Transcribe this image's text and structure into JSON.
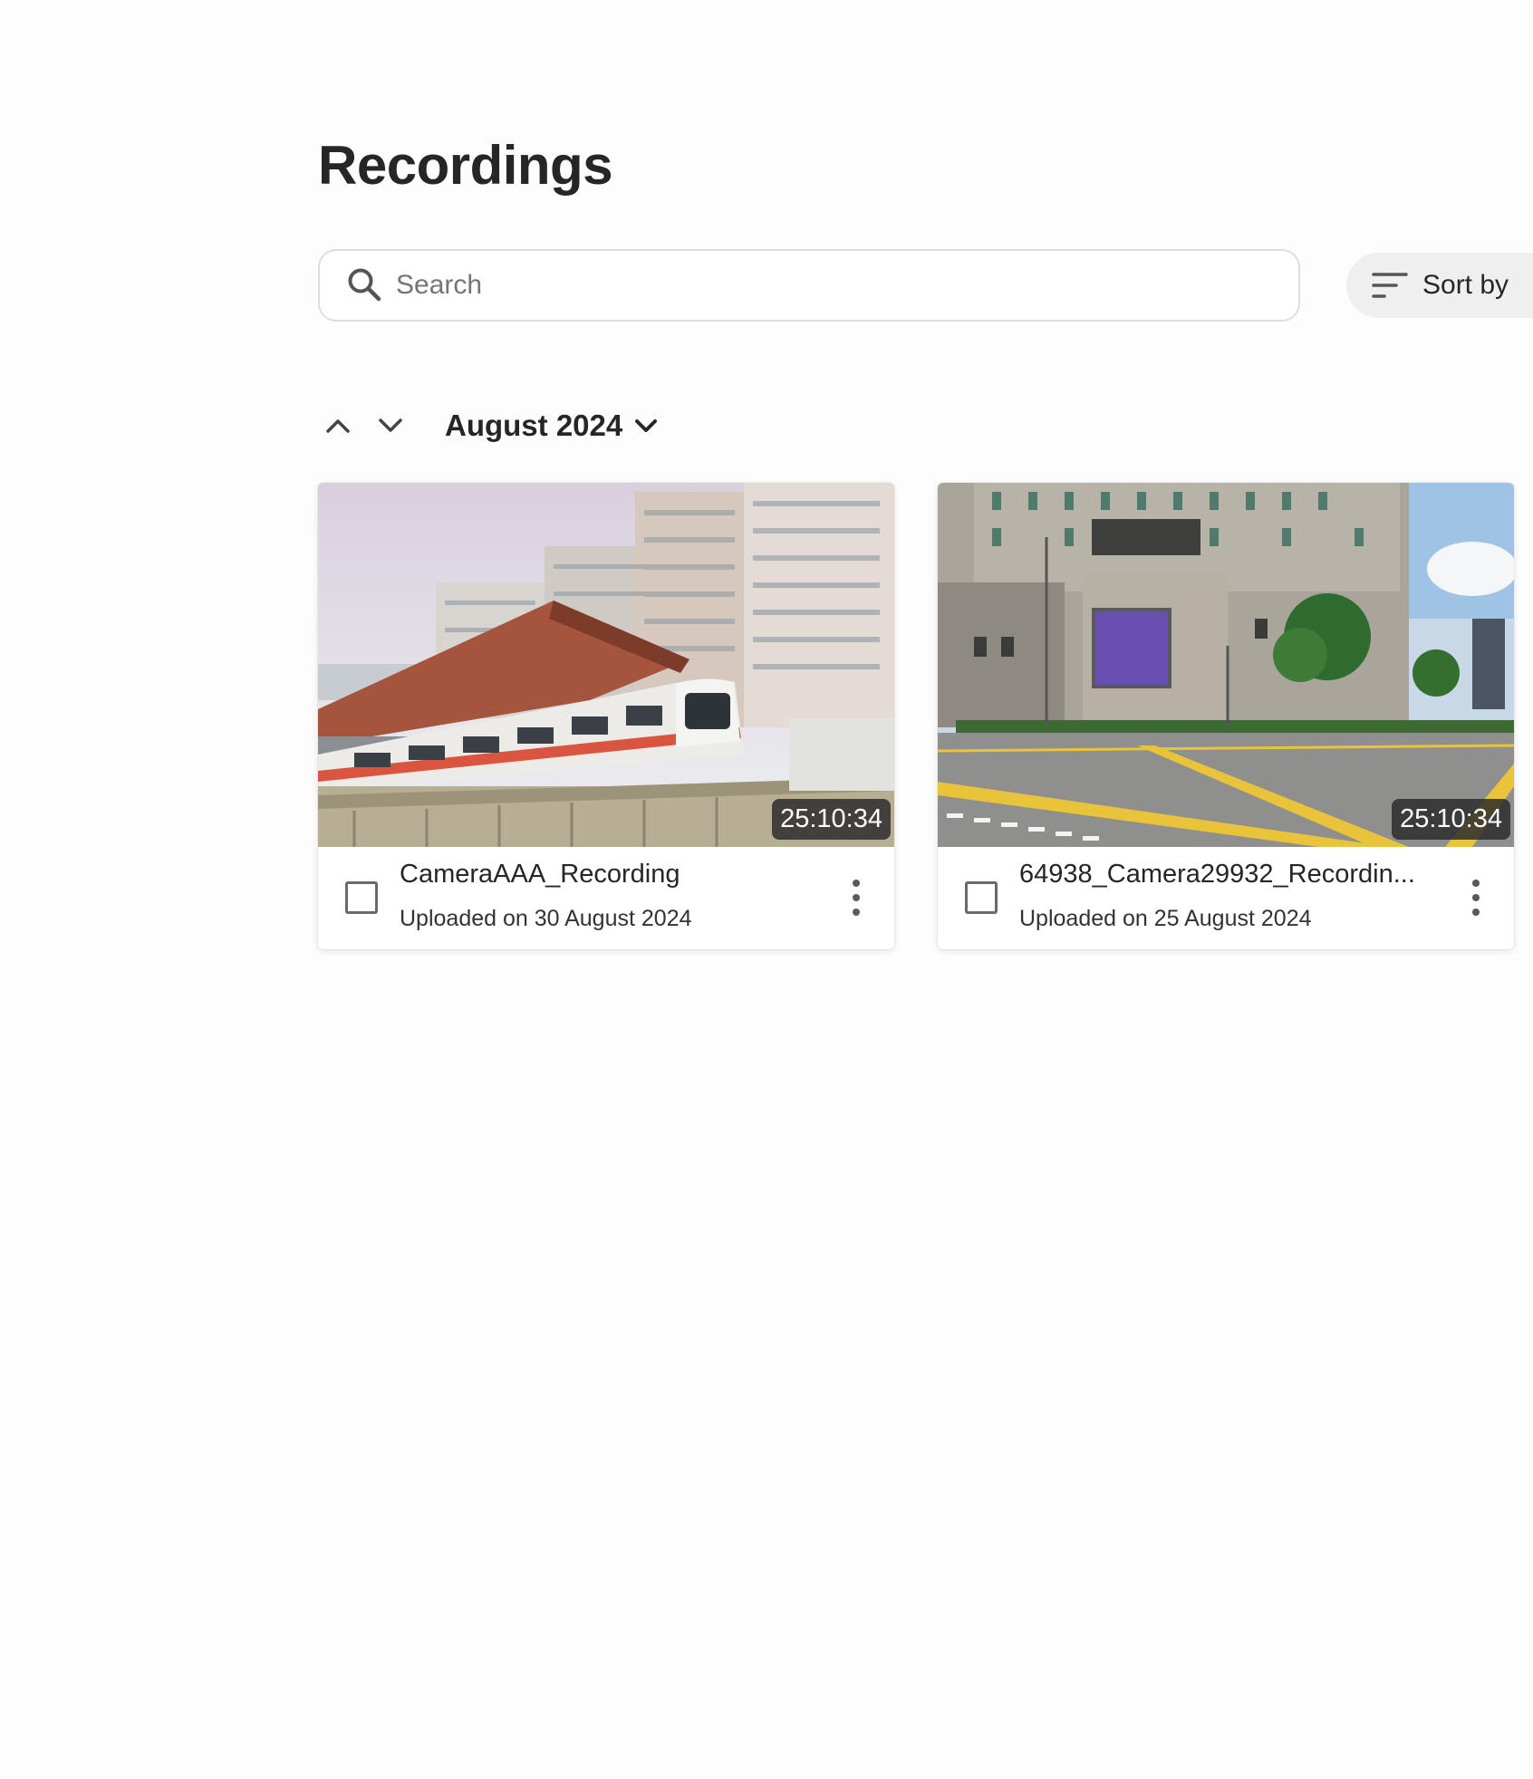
{
  "page": {
    "title": "Recordings"
  },
  "search": {
    "placeholder": "Search",
    "value": ""
  },
  "sort": {
    "label": "Sort by"
  },
  "month_nav": {
    "label": "August 2024"
  },
  "recordings": [
    {
      "title": "CameraAAA_Recording",
      "uploaded": "Uploaded on 30 August 2024",
      "duration": "25:10:34"
    },
    {
      "title": "64938_Camera29932_Recordin...",
      "uploaded": "Uploaded on 25 August 2024",
      "duration": "25:10:34"
    }
  ],
  "icons": {
    "search": "search-icon",
    "sort": "sort-lines-icon",
    "prev": "chevron-up-icon",
    "next": "chevron-down-icon",
    "month_dropdown": "chevron-down-icon",
    "more": "more-vertical-icon"
  },
  "colors": {
    "text": "#262626",
    "border": "#dedede",
    "sort_bg": "#efefef",
    "badge_bg": "#2d2d2d"
  }
}
